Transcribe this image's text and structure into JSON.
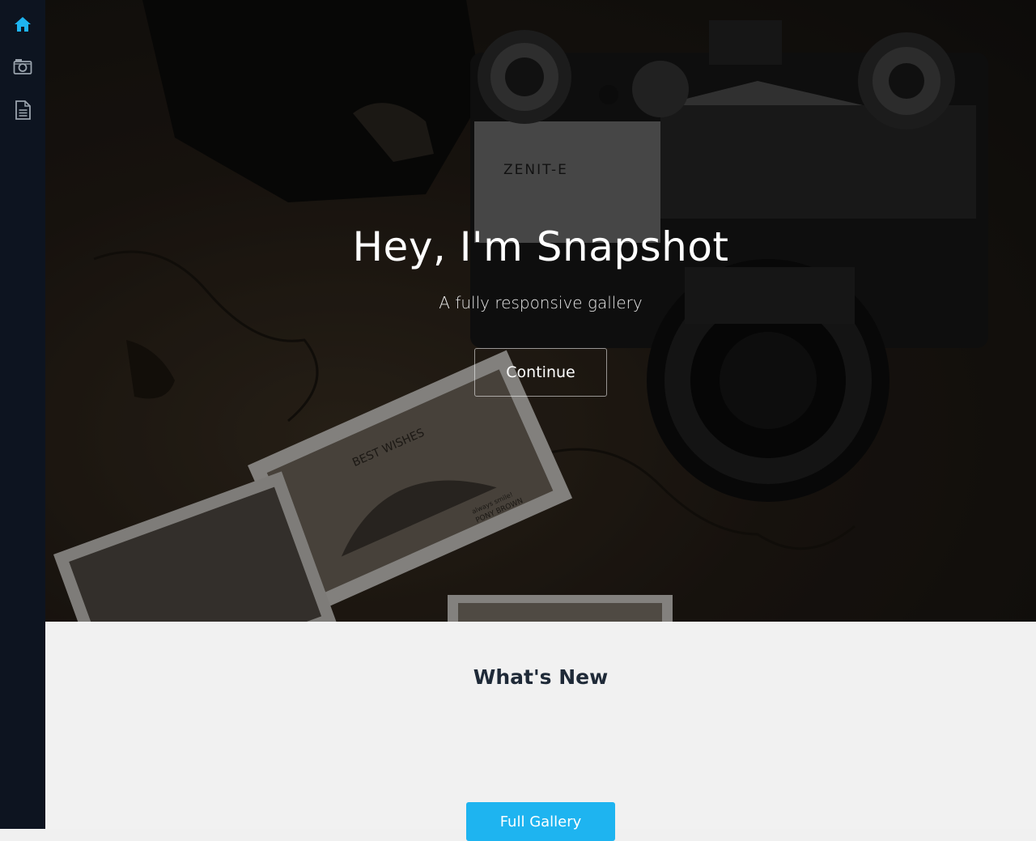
{
  "sidebar": {
    "items": [
      {
        "icon": "home-icon",
        "color": "#1eb4f0"
      },
      {
        "icon": "camera-icon",
        "color": "#9aa3ad"
      },
      {
        "icon": "document-icon",
        "color": "#9aa3ad"
      }
    ]
  },
  "hero": {
    "title": "Hey, I'm Snapshot",
    "subtitle": "A fully responsive gallery",
    "continue_label": "Continue",
    "camera_brand": "ZENIT-E",
    "postcard_text": "BEST WISHES",
    "postcard_caption_1": "always smile!",
    "postcard_caption_2": "PONY BROWN"
  },
  "whats_new": {
    "title": "What's New",
    "full_gallery_label": "Full Gallery"
  },
  "colors": {
    "accent": "#1eb4f0",
    "sidebar_bg": "#0d1420",
    "section_bg": "#f1f1f1"
  }
}
